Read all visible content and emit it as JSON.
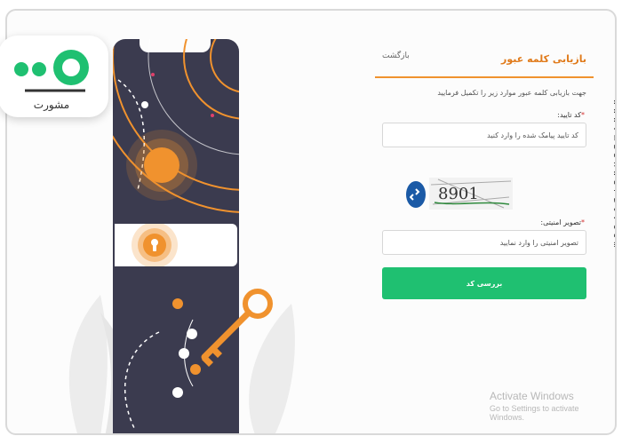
{
  "brand": {
    "logo_text": "مشورت",
    "watermark": "www.mashwerat.com"
  },
  "form": {
    "title": "بازیابی کلمه عبور",
    "back_label": "بازگشت",
    "instructions": "جهت بازیابی کلمه عبور موارد زیر را تکمیل فرمایید",
    "code_label": "کد تایید:",
    "code_placeholder": "کد تایید پیامک شده را وارد کنید",
    "captcha_text": "8901",
    "captcha_label": "تصویر امنیتی:",
    "captcha_placeholder": "تصویر امنیتی را وارد نمایید",
    "submit_label": "بررسی کد"
  },
  "os_overlay": {
    "title": "Activate Windows",
    "subtitle": "Go to Settings to activate Windows."
  },
  "colors": {
    "accent": "#f0922e",
    "submit": "#1fc071",
    "phone": "#3b3b4f",
    "refresh": "#1b5aa6"
  },
  "icons": {
    "refresh": "refresh-icon",
    "lock": "keyhole-lock-icon",
    "key": "key-illustration-icon"
  }
}
